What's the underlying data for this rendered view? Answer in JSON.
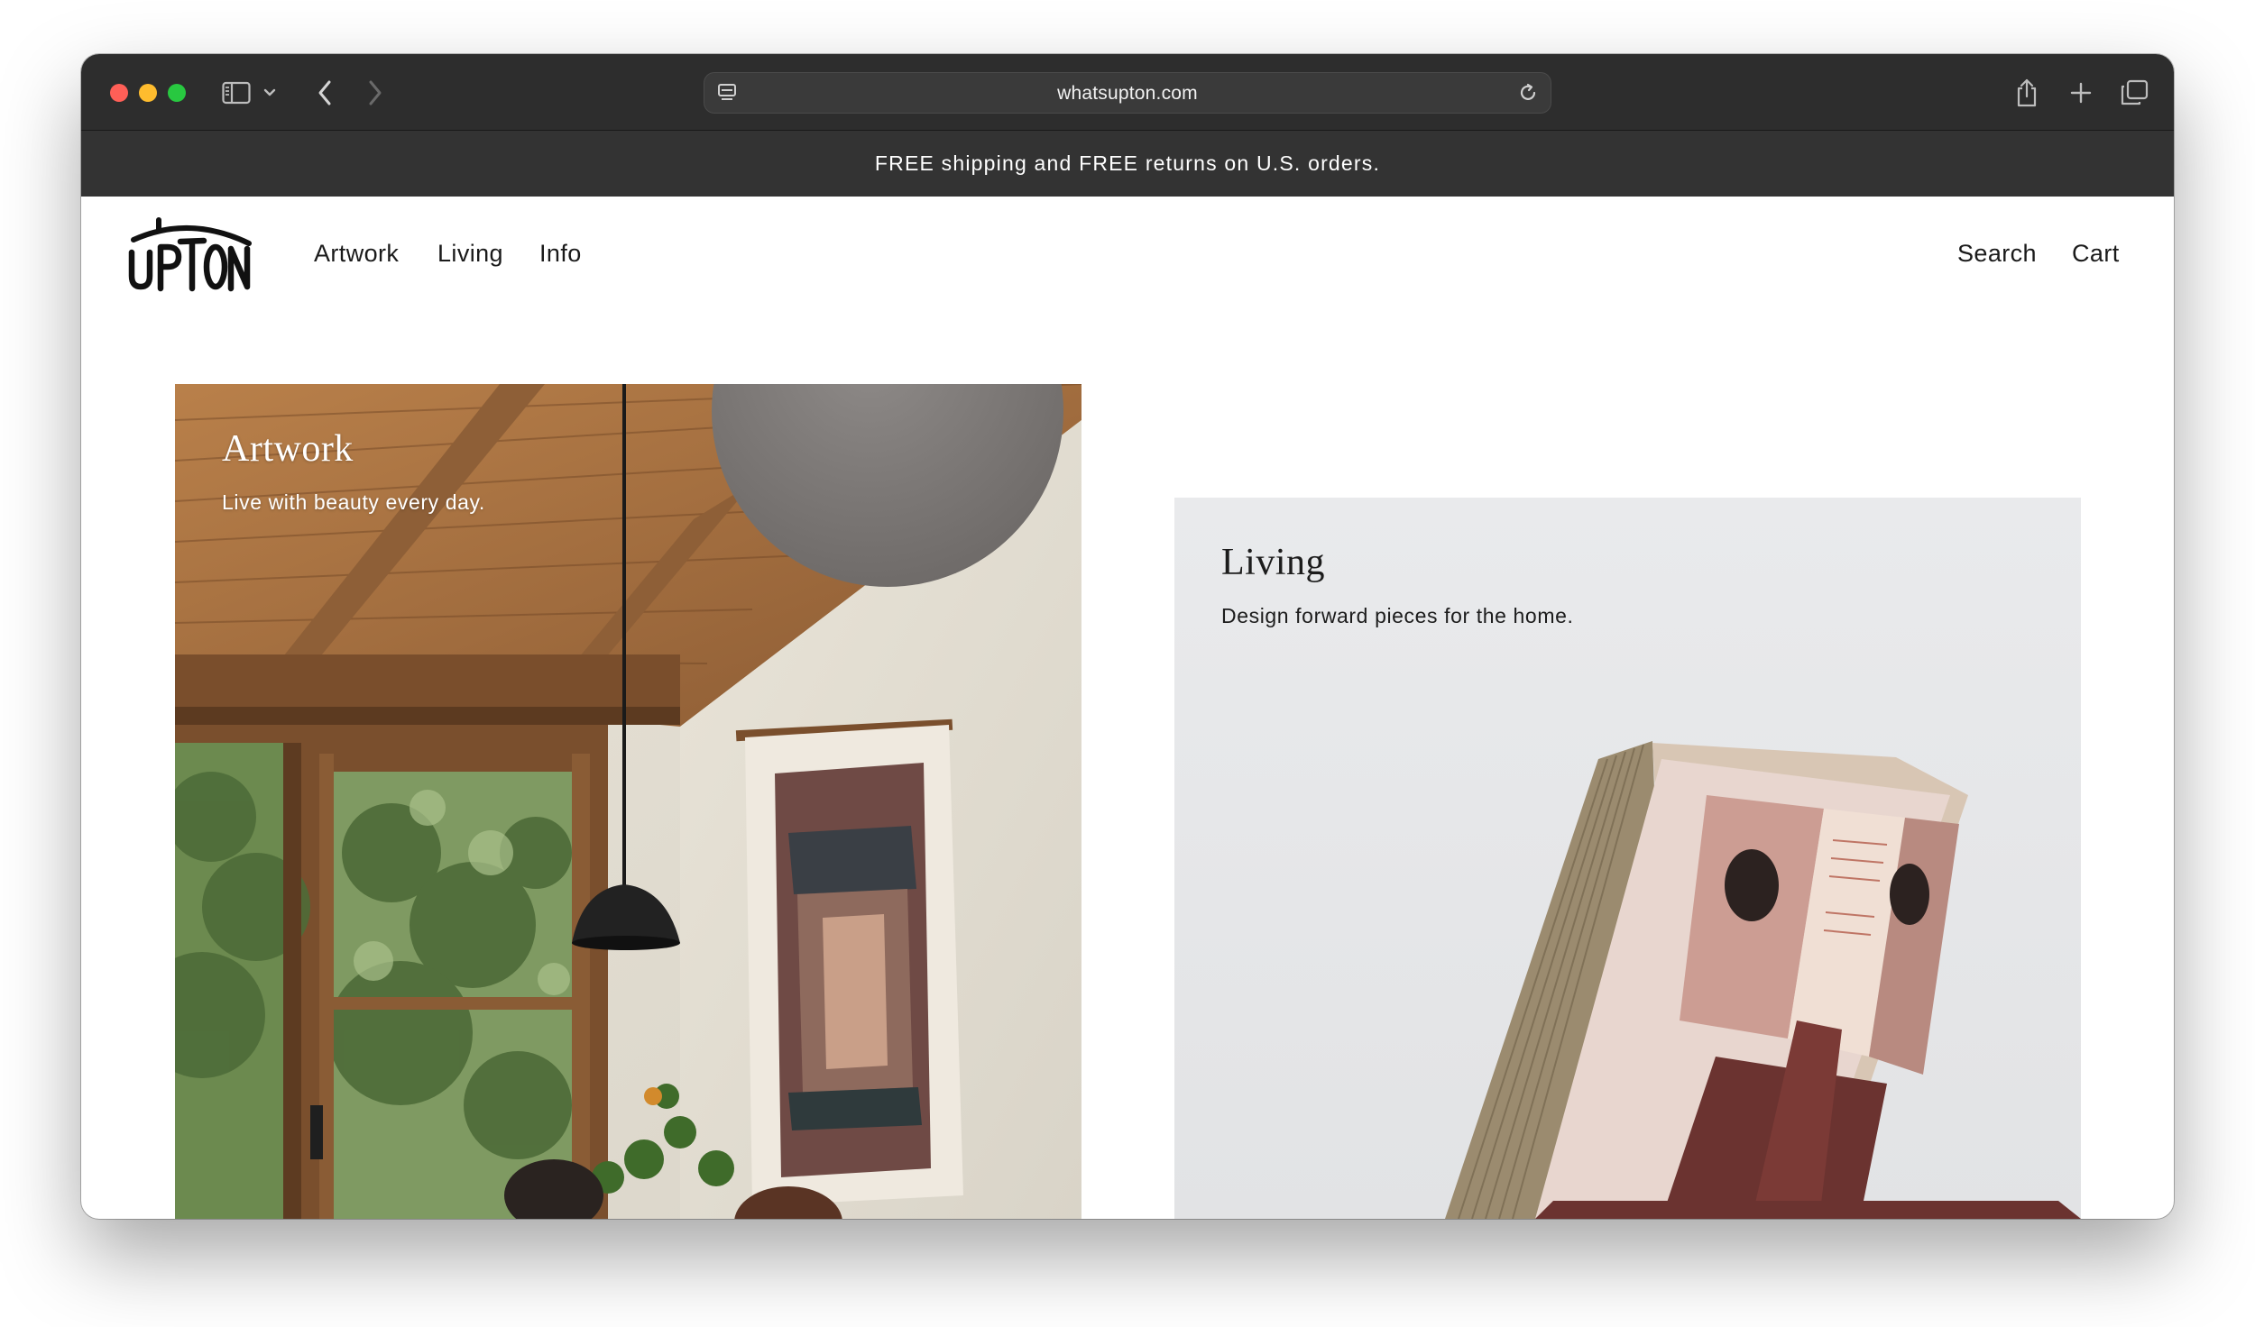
{
  "browser": {
    "url": "whatsupton.com",
    "icons": {
      "sidebar": "sidebar-icon",
      "back": "chevron-left-icon",
      "forward": "chevron-right-icon",
      "reload": "reload-icon",
      "share": "share-icon",
      "new_tab": "plus-icon",
      "tabs": "tab-overview-icon"
    }
  },
  "announcement": "FREE shipping and FREE returns on U.S. orders.",
  "header": {
    "logo_text": "UPTON",
    "nav": [
      "Artwork",
      "Living",
      "Info"
    ],
    "actions": {
      "search": "Search",
      "cart": "Cart"
    }
  },
  "cards": [
    {
      "title": "Artwork",
      "subtitle": "Live with beauty every day."
    },
    {
      "title": "Living",
      "subtitle": "Design forward pieces for the home."
    }
  ],
  "colors": {
    "toolbar_bg": "#2d2d2d",
    "announcement_bg": "#333333",
    "living_bg": "#e7e8ea"
  }
}
